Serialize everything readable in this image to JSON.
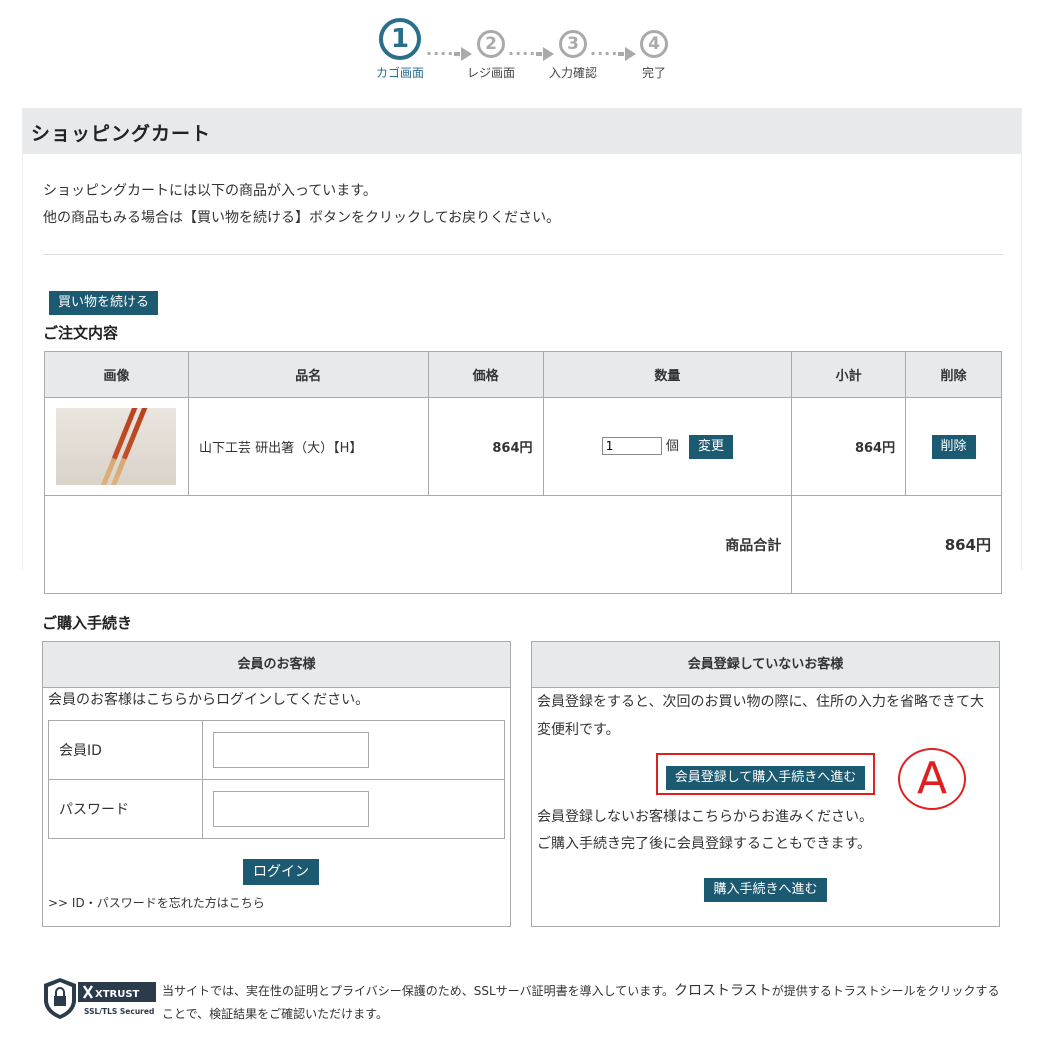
{
  "steps": [
    {
      "num": "1",
      "label": "カゴ画面",
      "active": true
    },
    {
      "num": "2",
      "label": "レジ画面",
      "active": false
    },
    {
      "num": "3",
      "label": "入力確認",
      "active": false
    },
    {
      "num": "4",
      "label": "完了",
      "active": false
    }
  ],
  "cart": {
    "title": "ショッピングカート",
    "intro_line1": "ショッピングカートには以下の商品が入っています。",
    "intro_line2": "他の商品もみる場合は【買い物を続ける】ボタンをクリックしてお戻りください。",
    "continue_button": "買い物を続ける",
    "order_title": "ご注文内容",
    "columns": [
      "画像",
      "品名",
      "価格",
      "数量",
      "小計",
      "削除"
    ],
    "items": [
      {
        "name": "山下工芸 研出箸（大）【H】",
        "price": "864円",
        "quantity": "1",
        "unit": "個",
        "change_button": "変更",
        "subtotal": "864円",
        "delete_button": "削除"
      }
    ],
    "total_label": "商品合計",
    "total_value": "864円"
  },
  "purchase": {
    "title": "ご購入手続き",
    "member": {
      "header": "会員のお客様",
      "text": "会員のお客様はこちらからログインしてください。",
      "id_label": "会員ID",
      "id_value": "",
      "password_label": "パスワード",
      "password_value": "",
      "login_button": "ログイン",
      "forgot_link": ">> ID・パスワードを忘れた方はこちら"
    },
    "guest": {
      "header": "会員登録していないお客様",
      "text1": "会員登録をすると、次回のお買い物の際に、住所の入力を省略できて大変便利です。",
      "register_button": "会員登録して購入手続きへ進む",
      "text2": "会員登録しないお客様はこちらからお進みください。",
      "text3": "ご購入手続き完了後に会員登録することもできます。",
      "proceed_button": "購入手続きへ進む"
    },
    "annotation_marker": "A"
  },
  "footer": {
    "seal_brand": "XTRUST",
    "seal_sub": "SSL/TLS Secured",
    "text_part1": "当サイトでは、実在性の証明とプライバシー保護のため、SSLサーバ証明書を導入しています。",
    "text_part2": "クロストラスト",
    "text_part3": "が提供するトラストシールをクリックすることで、検証結果をご確認いただけます。"
  },
  "colors": {
    "accent": "#1c5a72",
    "step_active": "#2a6e8c",
    "annotation": "#e02020"
  }
}
